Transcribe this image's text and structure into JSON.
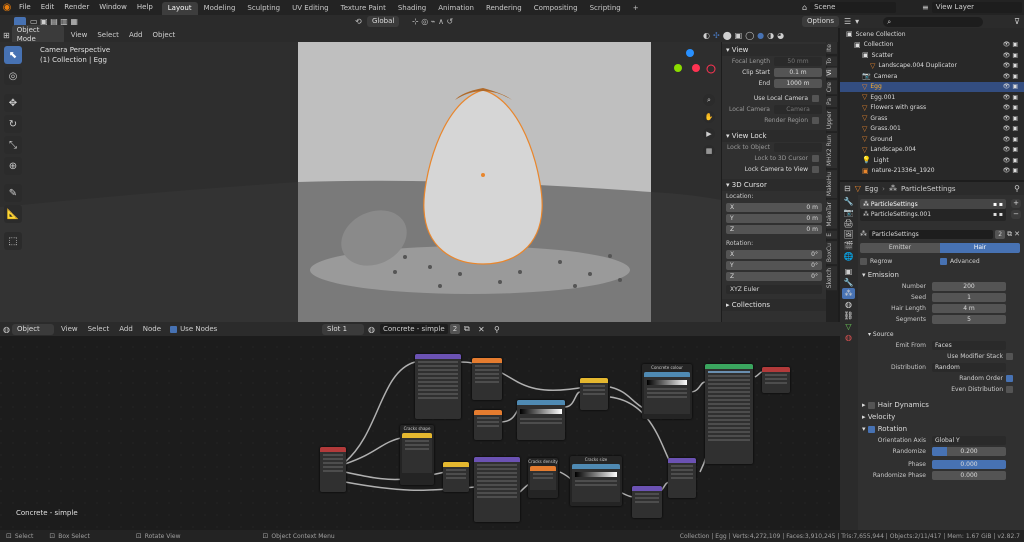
{
  "top_menu": [
    "File",
    "Edit",
    "Render",
    "Window",
    "Help"
  ],
  "workspaces": [
    "Layout",
    "Modeling",
    "Sculpting",
    "UV Editing",
    "Texture Paint",
    "Shading",
    "Animation",
    "Rendering",
    "Compositing",
    "Scripting"
  ],
  "active_workspace": "Layout",
  "plus_label": "+",
  "scene": {
    "name": "Scene",
    "view_layer": "View Layer"
  },
  "viewport_header": {
    "mode": "Object Mode",
    "menus": [
      "View",
      "Select",
      "Add",
      "Object"
    ],
    "orientation": "Global",
    "options": "Options"
  },
  "viewport": {
    "camera_label": "Camera Perspective",
    "collection_label": "(1) Collection | Egg"
  },
  "npanel": {
    "view_title": "View",
    "focal_length_label": "Focal Length",
    "focal_length": "50 mm",
    "clip_start_label": "Clip Start",
    "clip_start": "0.1 m",
    "end_label": "End",
    "end": "1000 m",
    "use_local_camera": "Use Local Camera",
    "local_camera_label": "Local Camera",
    "local_camera": "Camera",
    "render_region": "Render Region",
    "view_lock_title": "View Lock",
    "lock_to_object": "Lock to Object",
    "lock_to_3d_cursor": "Lock to 3D Cursor",
    "lock_camera_to_view": "Lock Camera to View",
    "cursor_title": "3D Cursor",
    "location_label": "Location:",
    "rotation_label": "Rotation:",
    "x": "X",
    "y": "Y",
    "z": "Z",
    "loc_x": "0 m",
    "loc_y": "0 m",
    "loc_z": "0 m",
    "rot_x": "0°",
    "rot_y": "0°",
    "rot_z": "0°",
    "rot_mode": "XYZ Euler",
    "collections_title": "Collections"
  },
  "side_tabs": [
    "Ite",
    "To",
    "Vi",
    "Cre",
    "Pa",
    "Upper",
    "MHX2 Run",
    "MakeHu",
    "MakeTar",
    "E",
    "BoxCu",
    "Sketch"
  ],
  "outliner": [
    {
      "name": "Scene Collection",
      "indent": 0,
      "icon": "box"
    },
    {
      "name": "Collection",
      "indent": 1,
      "icon": "box"
    },
    {
      "name": "Scatter",
      "indent": 2,
      "icon": "box"
    },
    {
      "name": "Landscape.004 Duplicator",
      "indent": 3,
      "icon": "tri"
    },
    {
      "name": "Camera",
      "indent": 2,
      "icon": "cam"
    },
    {
      "name": "Egg",
      "indent": 2,
      "icon": "tri",
      "selected": true
    },
    {
      "name": "Egg.001",
      "indent": 2,
      "icon": "tri"
    },
    {
      "name": "Flowers with grass",
      "indent": 2,
      "icon": "tri"
    },
    {
      "name": "Grass",
      "indent": 2,
      "icon": "tri"
    },
    {
      "name": "Grass.001",
      "indent": 2,
      "icon": "tri"
    },
    {
      "name": "Ground",
      "indent": 2,
      "icon": "tri"
    },
    {
      "name": "Landscape.004",
      "indent": 2,
      "icon": "tri"
    },
    {
      "name": "Light",
      "indent": 2,
      "icon": "light"
    },
    {
      "name": "nature-213364_1920",
      "indent": 2,
      "icon": "img"
    }
  ],
  "properties": {
    "breadcrumb_object": "Egg",
    "breadcrumb_psys": "ParticleSettings",
    "psys_list": [
      "ParticleSettings",
      "ParticleSettings.001"
    ],
    "settings_name": "ParticleSettings",
    "settings_users": "2",
    "type_emitter": "Emitter",
    "type_hair": "Hair",
    "regrow": "Regrow",
    "advanced": "Advanced",
    "emission": "Emission",
    "number_label": "Number",
    "number": "200",
    "seed_label": "Seed",
    "seed": "1",
    "hair_length_label": "Hair Length",
    "hair_length": "4 m",
    "segments_label": "Segments",
    "segments": "5",
    "source": "Source",
    "emit_from_label": "Emit From",
    "emit_from": "Faces",
    "use_modifier_stack": "Use Modifier Stack",
    "distribution_label": "Distribution",
    "distribution": "Random",
    "random_order": "Random Order",
    "even_distribution": "Even Distribution",
    "hair_dynamics": "Hair Dynamics",
    "velocity": "Velocity",
    "rotation": "Rotation",
    "orientation_axis_label": "Orientation Axis",
    "orientation_axis": "Global Y",
    "randomize_label": "Randomize",
    "randomize": "0.200",
    "randomize_fill": 0.2,
    "phase_label": "Phase",
    "phase": "0.000",
    "randomize_phase_label": "Randomize Phase",
    "randomize_phase": "0.000"
  },
  "node_header": {
    "type": "Object",
    "menus": [
      "View",
      "Select",
      "Add",
      "Node"
    ],
    "use_nodes": "Use Nodes",
    "slot": "Slot 1",
    "material": "Concrete - simple",
    "users": "2"
  },
  "node_editor": {
    "material_label": "Concrete - simple",
    "node_titles": {
      "cracks_shape": "Cracks shape",
      "cracks_density": "Cracks density",
      "concrete_colour": "Concrete colour",
      "cracks_size": "Cracks size"
    }
  },
  "status": {
    "select": "Select",
    "box_select": "Box Select",
    "rotate_view": "Rotate View",
    "context_menu": "Object Context Menu",
    "stats": "Collection | Egg | Verts:4,272,109 | Faces:3,910,245 | Tris:7,655,944 | Objects:2/11/417 | Mem: 1.67 GiB | v2.82.7"
  },
  "colors": {
    "accent": "#4772b3",
    "selection": "#e8862d",
    "active_bg": "#334d80"
  }
}
